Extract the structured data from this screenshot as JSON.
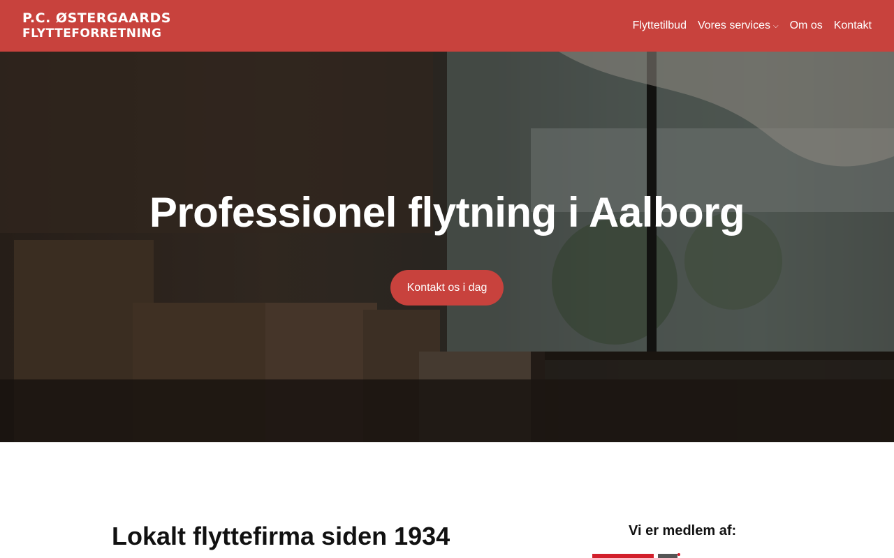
{
  "brand": {
    "line1": "P.C. ØSTERGAARDS",
    "line2": "FLYTTEFORRETNING",
    "color": "#c8423d"
  },
  "nav": {
    "items": [
      {
        "label": "Flyttetilbud"
      },
      {
        "label": "Vores services",
        "has_dropdown": true
      },
      {
        "label": "Om os"
      },
      {
        "label": "Kontakt"
      }
    ],
    "dropdown_glyph": "⌵"
  },
  "hero": {
    "title": "Professionel flytning i Aalborg",
    "cta_label": "Kontakt os i dag"
  },
  "intro": {
    "title": "Lokalt flyttefirma siden 1934"
  },
  "members": {
    "title": "Vi er medlem af:"
  }
}
